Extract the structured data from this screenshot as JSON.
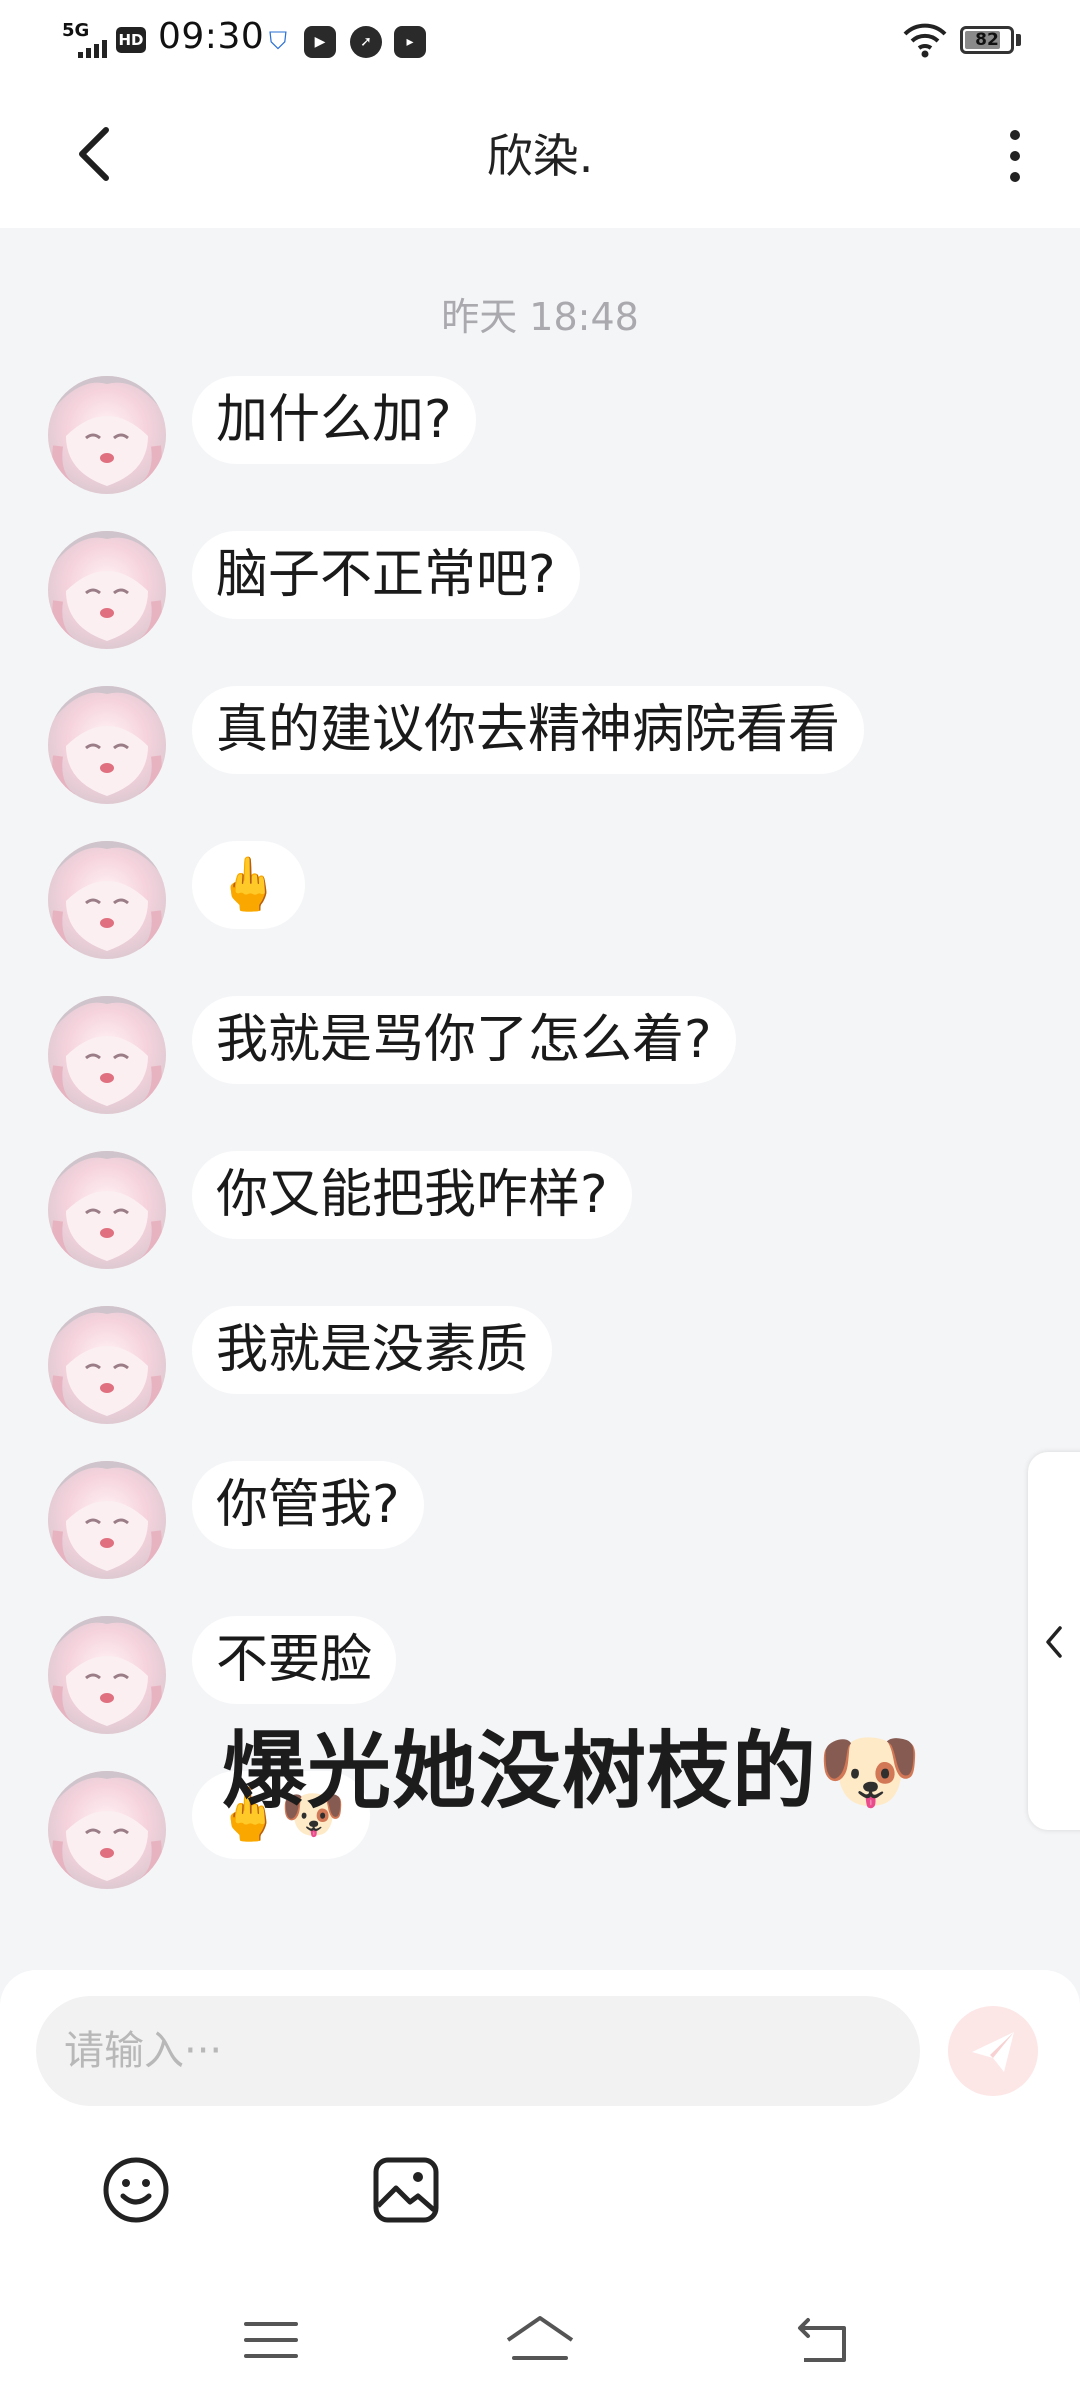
{
  "status_bar": {
    "network": "5G",
    "hd_label": "HD",
    "time": "09:30",
    "battery": "82",
    "battery_level": 0.82
  },
  "header": {
    "title": "欣染."
  },
  "chat": {
    "timestamp": "昨天 18:48",
    "messages": [
      {
        "text": "加什么加?"
      },
      {
        "text": "脑子不正常吧?"
      },
      {
        "text": "真的建议你去精神病院看看"
      },
      {
        "text": "🖕"
      },
      {
        "text": "我就是骂你了怎么着?"
      },
      {
        "text": "你又能把我咋样?"
      },
      {
        "text": "我就是没素质"
      },
      {
        "text": "你管我?"
      },
      {
        "text": "不要脸"
      },
      {
        "text": "🖕🐶"
      }
    ]
  },
  "overlay_caption": "爆光她没树枝的🐶",
  "input": {
    "placeholder": "请输入···"
  },
  "icons": {
    "back": "chevron-left-icon",
    "more": "more-vertical-icon",
    "send": "send-icon",
    "emoji": "smiley-icon",
    "image": "image-icon",
    "side_tab": "chevron-left-icon",
    "nav_menu": "menu-icon",
    "nav_home": "home-icon",
    "nav_back": "back-icon"
  },
  "colors": {
    "chat_background": "#f4f5f7",
    "bubble": "#ffffff",
    "send_button": "#fde6e6",
    "timestamp": "#a9a9ae"
  }
}
